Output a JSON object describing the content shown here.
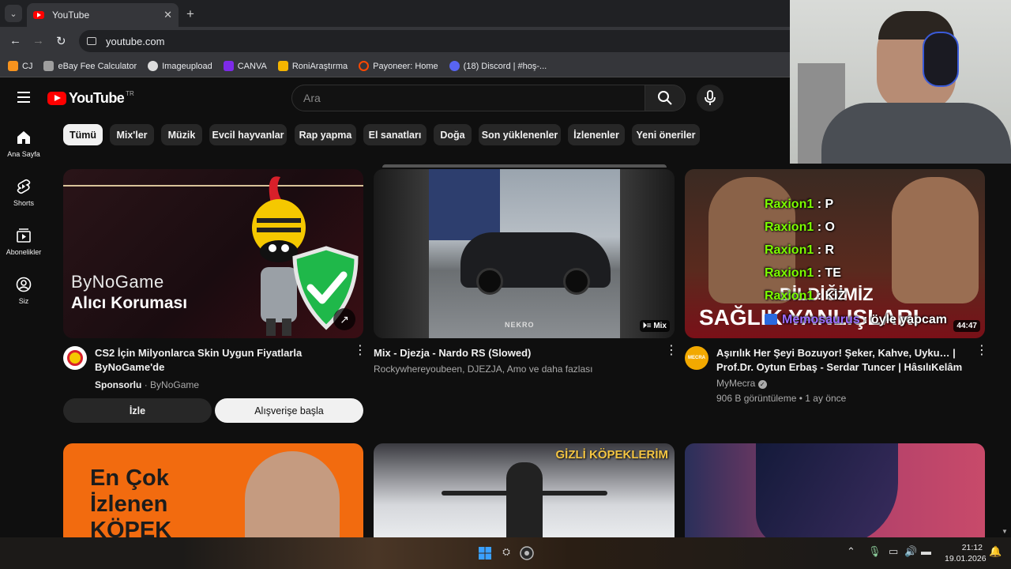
{
  "browser": {
    "tab_title": "YouTube",
    "url": "youtube.com",
    "bookmarks": [
      {
        "label": "CJ",
        "color": "#f7931e"
      },
      {
        "label": "eBay Fee Calculator",
        "color": "#9e9e9e"
      },
      {
        "label": "Imageupload",
        "color": "#dddddd"
      },
      {
        "label": "CANVA",
        "color": "#7d2ae8"
      },
      {
        "label": "RoniAraştırma",
        "color": "#f4b400"
      },
      {
        "label": "Payoneer: Home",
        "color": "#ff4800"
      },
      {
        "label": "(18) Discord | #hoş-...",
        "color": "#5865f2"
      }
    ]
  },
  "header": {
    "logo_text": "YouTube",
    "logo_region": "TR",
    "search_placeholder": "Ara"
  },
  "sidebar": {
    "items": [
      {
        "label": "Ana Sayfa",
        "icon": "home-icon"
      },
      {
        "label": "Shorts",
        "icon": "shorts-icon"
      },
      {
        "label": "Abonelikler",
        "icon": "subscriptions-icon"
      },
      {
        "label": "Siz",
        "icon": "you-icon"
      }
    ]
  },
  "chips": [
    "Tümü",
    "Mix'ler",
    "Müzik",
    "Evcil hayvanlar",
    "Rap yapma",
    "El sanatları",
    "Doğa",
    "Son yüklenenler",
    "İzlenenler",
    "Yeni öneriler"
  ],
  "videos": [
    {
      "title": "CS2 İçin Milyonlarca Skin Uygun Fiyatlarla ByNoGame'de",
      "sponsor_label": "Sponsorlu",
      "channel": "ByNoGame",
      "thumb_brand": "ByNoGame",
      "thumb_subtitle": "Alıcı Koruması",
      "watch_button": "İzle",
      "shop_button": "Alışverişe başla"
    },
    {
      "title": "Mix - Djezja - Nardo RS (Slowed)",
      "channel": "Rockywhereyoubeen, DJEZJA, Amo ve daha fazlası",
      "badge": "Mix",
      "thumb_watermark": "NEKRO"
    },
    {
      "title": "Aşırılık Her Şeyi Bozuyor! Şeker, Kahve, Uyku… | Prof.Dr. Oytun Erbaş - Serdar Tuncer  | HâsılıKelâm",
      "channel": "MyMecra",
      "channel_avatar_text": "MECRA",
      "stats": "906 B görüntüleme • 1 ay önce",
      "duration": "44:47",
      "thumb_text_top": "BİLDİĞİMİZ",
      "thumb_text_bottom": "SAĞLIK YANLIŞLARI"
    }
  ],
  "row2": {
    "video4_thumb_lines": [
      "En Çok",
      "İzlenen",
      "KÖPEK"
    ],
    "video5_thumb_title": "GİZLİ KÖPEKLERİM"
  },
  "stream_chat": [
    {
      "user": "Raxion1",
      "message": " : P"
    },
    {
      "user": "Raxion1",
      "message": " : O"
    },
    {
      "user": "Raxion1",
      "message": " : R"
    },
    {
      "user": "Raxion1",
      "message": " : TE"
    },
    {
      "user": "Raxion1",
      "message": " : KİZ"
    },
    {
      "user": "Memosaurus",
      "message": " : öyle yapcam"
    }
  ],
  "taskbar": {
    "time": "21:12",
    "date": "19.01.2026"
  },
  "colors": {
    "background": "#0f0f0f",
    "accent_red": "#ff0000",
    "chat_name": "#7CFC00"
  }
}
